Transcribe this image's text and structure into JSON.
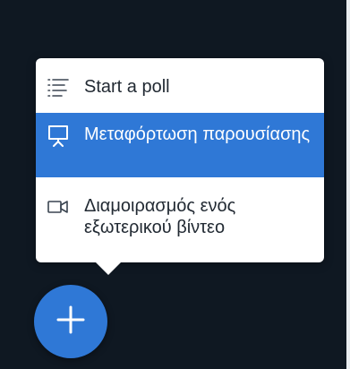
{
  "menu": {
    "items": [
      {
        "label": "Start a poll",
        "icon": "list-icon"
      },
      {
        "label": "Μεταφόρτωση παρουσίασης",
        "icon": "presentation-icon",
        "selected": true
      },
      {
        "label": "Διαμοιρασμός ενός εξωτερικού βίντεο",
        "icon": "video-camera-icon"
      }
    ]
  },
  "fab": {
    "icon": "plus-icon"
  },
  "colors": {
    "accent": "#2f78d6",
    "background": "#0f1822",
    "menu_background": "#ffffff",
    "text": "#222a33"
  }
}
